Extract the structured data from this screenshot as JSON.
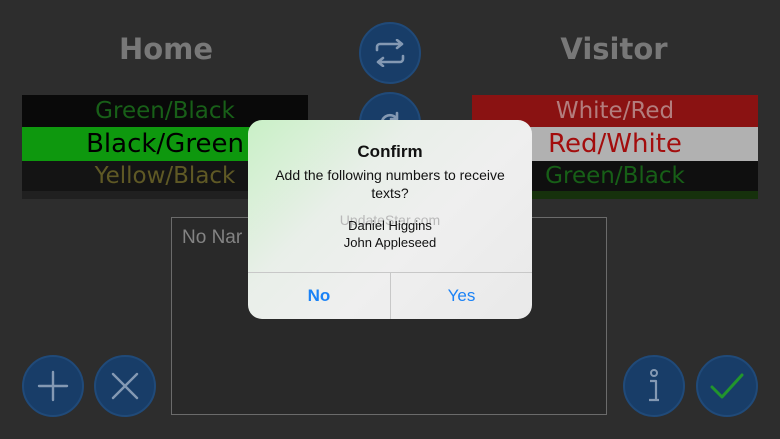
{
  "home": {
    "title": "Home",
    "picker": {
      "above": {
        "label": "Green/Black",
        "bg": "#0c0c0c",
        "fg": "#1f7a1f"
      },
      "selected": {
        "label": "Black/Green",
        "bg": "#12c312",
        "fg": "#000000"
      },
      "below": {
        "label": "Yellow/Black",
        "bg": "#1a1a1a",
        "fg": "#7a7230"
      },
      "below2": {
        "bg": "#2a2a2a"
      }
    }
  },
  "visitor": {
    "title": "Visitor",
    "picker": {
      "above": {
        "label": "White/Red",
        "bg": "#b11818",
        "fg": "#e6a0a0"
      },
      "selected": {
        "label": "Red/White",
        "bg": "#e3e3e3",
        "fg": "#d11111"
      },
      "below": {
        "label": "Green/Black",
        "bg": "#141414",
        "fg": "#1e7a1e"
      },
      "below2": {
        "bg": "#1d3f10"
      }
    }
  },
  "names_box": {
    "placeholder": "No Nar"
  },
  "alert": {
    "title": "Confirm",
    "message": "Add the following numbers to receive texts?",
    "watermark": "UpdateStar.com",
    "names": [
      "Daniel  Higgins",
      "John  Appleseed"
    ],
    "no_label": "No",
    "yes_label": "Yes"
  },
  "colors": {
    "accent": "#1a82f6",
    "button_fill": "#1f4f86",
    "confirm_green": "#2bbf3a"
  },
  "icons": [
    "swap-icon",
    "redo-icon",
    "plus-icon",
    "close-icon",
    "info-icon",
    "checkmark-icon"
  ]
}
